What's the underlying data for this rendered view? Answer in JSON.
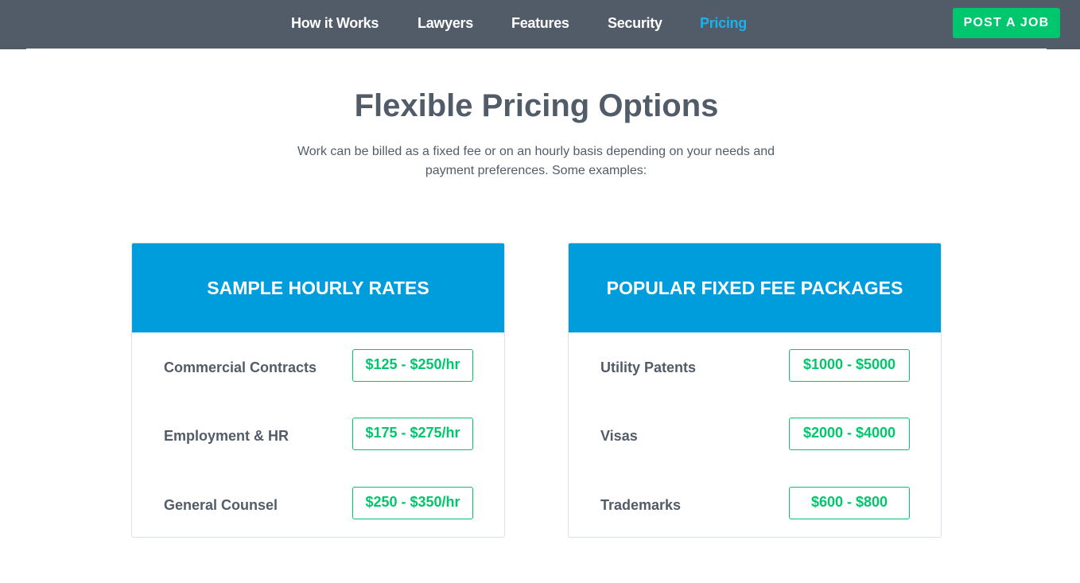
{
  "nav": {
    "links": [
      {
        "label": "How it Works",
        "active": false
      },
      {
        "label": "Lawyers",
        "active": false
      },
      {
        "label": "Features",
        "active": false
      },
      {
        "label": "Security",
        "active": false
      },
      {
        "label": "Pricing",
        "active": true
      }
    ],
    "cta_label": "POST A JOB"
  },
  "hero": {
    "title": "Flexible Pricing Options",
    "subtitle": "Work can be billed as a fixed fee or on an hourly basis depending on your needs and payment preferences. Some examples:"
  },
  "cards": [
    {
      "title": "SAMPLE HOURLY RATES",
      "rows": [
        {
          "label": "Commercial Contracts",
          "price": "$125 - $250/hr"
        },
        {
          "label": "Employment & HR",
          "price": "$175 - $275/hr"
        },
        {
          "label": "General Counsel",
          "price": "$250 - $350/hr"
        }
      ]
    },
    {
      "title": "POPULAR FIXED FEE PACKAGES",
      "rows": [
        {
          "label": "Utility Patents",
          "price": "$1000 - $5000"
        },
        {
          "label": "Visas",
          "price": "$2000 - $4000"
        },
        {
          "label": "Trademarks",
          "price": "$600 - $800"
        }
      ]
    }
  ],
  "colors": {
    "nav_bg": "#525c69",
    "active_link": "#1ab1ed",
    "cta_green": "#00c66d",
    "card_header_blue": "#009ddc",
    "price_green": "#00c66d"
  }
}
